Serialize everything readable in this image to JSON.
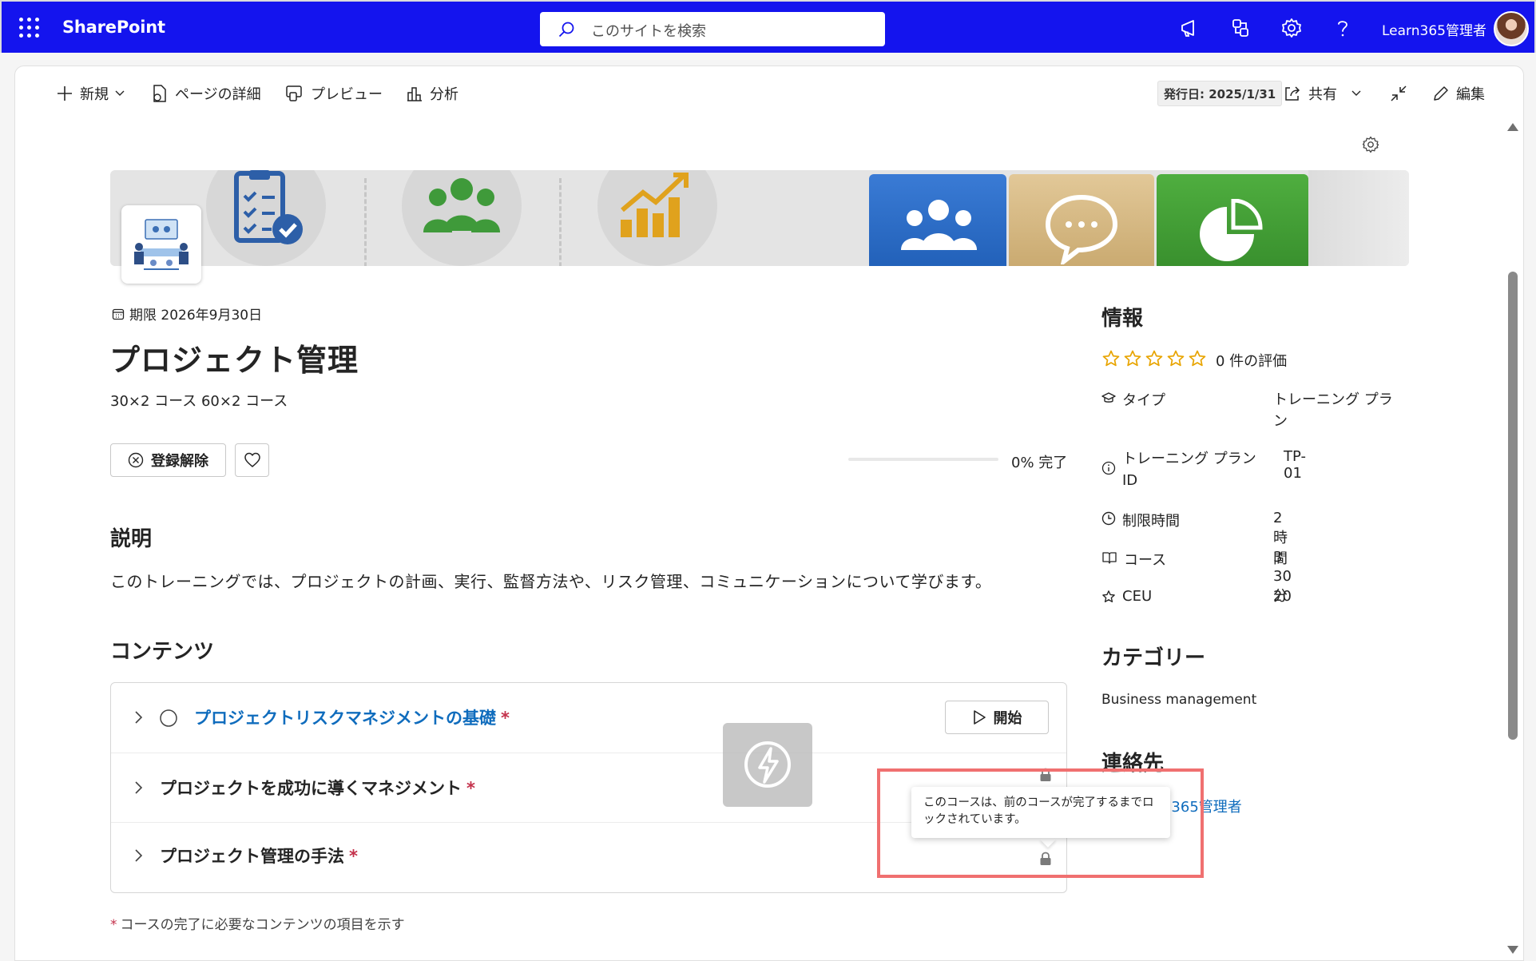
{
  "app": {
    "brand": "SharePoint",
    "user_name": "Learn365管理者"
  },
  "search": {
    "placeholder": "このサイトを検索"
  },
  "toolbar": {
    "new_label": "新規",
    "page_details_label": "ページの詳細",
    "preview_label": "プレビュー",
    "analytics_label": "分析",
    "published": "発行日: 2025/1/31",
    "share_label": "共有",
    "edit_label": "編集"
  },
  "course": {
    "deadline": "期限 2026年9月30日",
    "title": "プロジェクト管理",
    "subtitle": "30×2 コース 60×2 コース",
    "unregister_label": "登録解除",
    "progress_text": "0% 完了",
    "progress_fraction": 0.0,
    "description_heading": "説明",
    "description": "このトレーニングでは、プロジェクトの計画、実行、監督方法や、リスク管理、コミュニケーションについて学びます。",
    "contents_heading": "コンテンツ",
    "items": [
      {
        "title": "プロジェクトリスクマネジメントの基礎",
        "required_mark": "*",
        "action": "開始"
      },
      {
        "title": "プロジェクトを成功に導くマネジメント",
        "required_mark": "*"
      },
      {
        "title": "プロジェクト管理の手法",
        "required_mark": "*"
      }
    ],
    "footnote_mark": "*",
    "footnote": "コースの完了に必要なコンテンツの項目を示す"
  },
  "info": {
    "heading": "情報",
    "rating_text": "0 件の評価",
    "rating_value": 0,
    "rating_max": 5,
    "rows": [
      {
        "label": "タイプ",
        "value": "トレーニング プラ\nン",
        "icon": "graduation-cap-icon"
      },
      {
        "label": "トレーニング プラン\nID",
        "value": "TP-01",
        "icon": "info-icon"
      },
      {
        "label": "制限時間",
        "value": "2 時間 30 分",
        "icon": "clock-icon"
      },
      {
        "label": "コース",
        "value": "3",
        "icon": "book-icon"
      },
      {
        "label": "CEU",
        "value": "20",
        "icon": "star-outline-icon"
      }
    ],
    "category_heading": "カテゴリー",
    "category_value": "Business management",
    "contact_heading": "連絡先",
    "contact_visible_text": "n365管理者"
  },
  "tooltip": {
    "text": "このコースは、前のコースが完了するまでロックされています。"
  },
  "colors": {
    "suite_bar": "#1414EE",
    "link": "#0F6CBD",
    "required": "#C4314B",
    "highlight_box": "#F07070",
    "star": "#E8A400"
  }
}
